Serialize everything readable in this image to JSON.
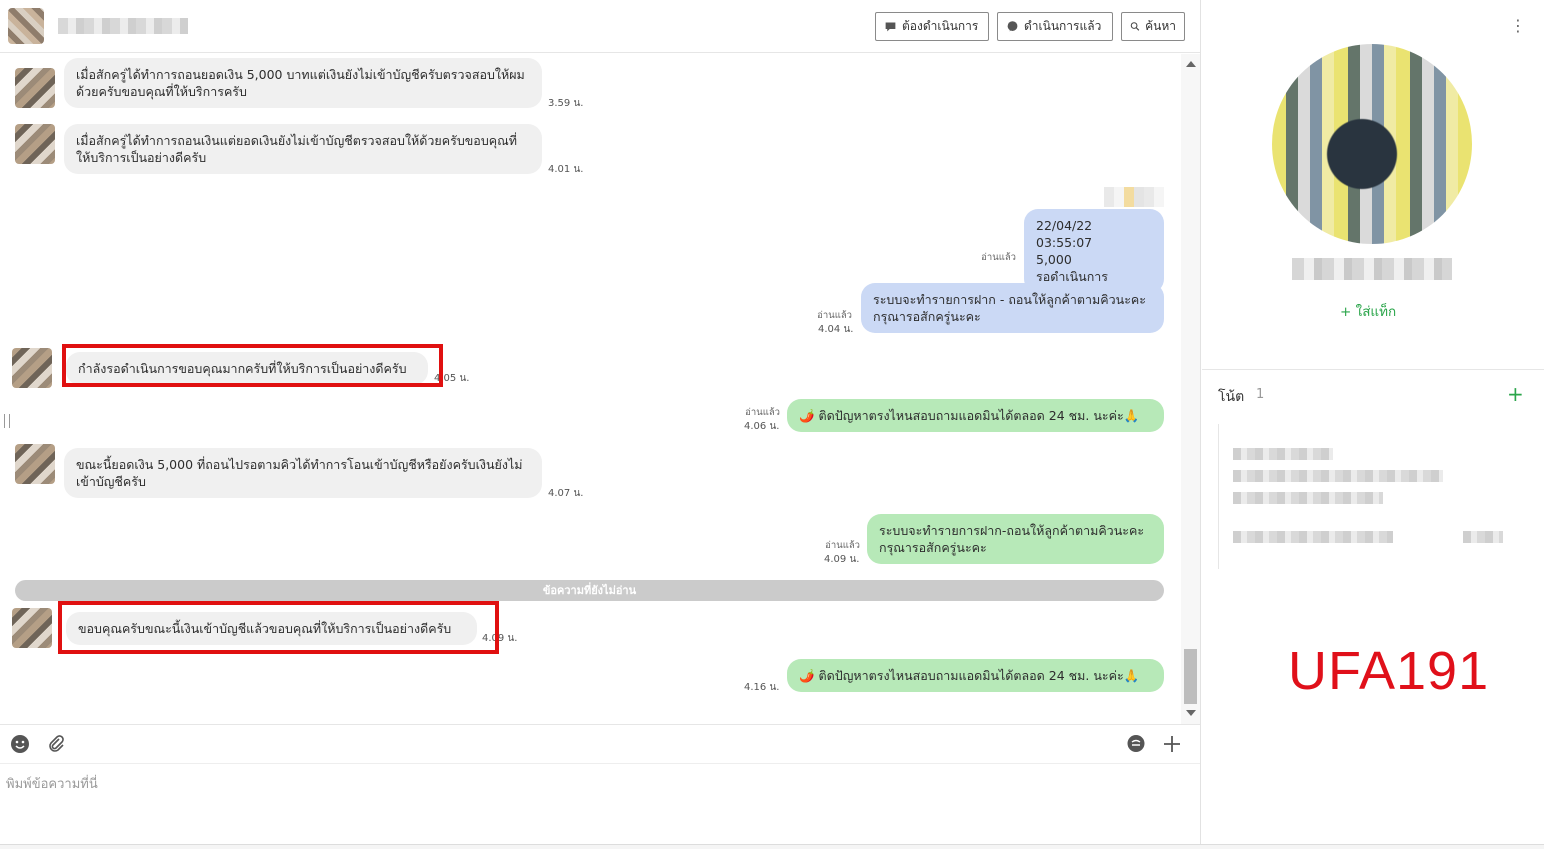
{
  "header": {
    "btn_pending": "ต้องดำเนินการ",
    "btn_done": "ดำเนินการแล้ว",
    "btn_search": "ค้นหา"
  },
  "messages": {
    "m1": {
      "text": "เมื่อสักครู่ได้ทำการถอนยอดเงิน 5,000 บาทแต่เงินยังไม่เข้าบัญชีครับตรวจสอบให้ผมด้วยครับขอบคุณที่ให้บริการครับ",
      "time": "3.59 น."
    },
    "m2": {
      "text": "เมื่อสักครู่ได้ทำการถอนเงินแต่ยอดเงินยังไม่เข้าบัญชีตรวจสอบให้ด้วยครับขอบคุณที่ให้บริการเป็นอย่างดีครับ",
      "time": "4.01 น."
    },
    "m3": {
      "line1": "22/04/22 03:55:07",
      "line2": "5,000",
      "line3": "รอดำเนินการ",
      "read": "อ่านแล้ว"
    },
    "m4": {
      "text": "ระบบจะทำรายการฝาก - ถอนให้ลูกค้าตามคิวนะคะ กรุณารอสักครู่นะคะ",
      "read": "อ่านแล้ว",
      "time": "4.04 น."
    },
    "m5": {
      "text": "กำลังรอดำเนินการขอบคุณมากครับที่ให้บริการเป็นอย่างดีครับ",
      "time": "4.05 น."
    },
    "m6": {
      "text": "🌶️ ติดปัญหาตรงไหนสอบถามแอดมินได้ตลอด 24 ชม. นะค่ะ🙏",
      "read": "อ่านแล้ว",
      "time": "4.06 น."
    },
    "m7": {
      "text": "ขณะนี้ยอดเงิน 5,000 ที่ถอนไปรอตามคิวได้ทำการโอนเข้าบัญชีหรือยังครับเงินยังไม่เข้าบัญชีครับ",
      "time": "4.07 น."
    },
    "m8": {
      "text": "ระบบจะทำรายการฝาก-ถอนให้ลูกค้าตามคิวนะคะ กรุณารอสักครู่นะคะ",
      "read": "อ่านแล้ว",
      "time": "4.09 น."
    },
    "unread_divider": "ข้อความที่ยังไม่อ่าน",
    "m9": {
      "text": "ขอบคุณครับขณะนี้เงินเข้าบัญชีแล้วขอบคุณที่ให้บริการเป็นอย่างดีครับ",
      "time": "4.09 น."
    },
    "m10": {
      "text": "🌶️ ติดปัญหาตรงไหนสอบถามแอดมินได้ตลอด 24 ชม. นะค่ะ🙏",
      "time": "4.16 น."
    }
  },
  "composer": {
    "placeholder": "พิมพ์ข้อความที่นี่"
  },
  "panel": {
    "add_tag": "+ ใส่แท็ก",
    "note_title": "โน้ต",
    "note_count": "1",
    "note_add": "+",
    "watermark": "UFA191"
  },
  "colors": {
    "accent_green": "#2aa54a",
    "highlight_red": "#e01010",
    "bubble_green": "#b7e9b8",
    "bubble_blue": "#cbd9f5"
  }
}
